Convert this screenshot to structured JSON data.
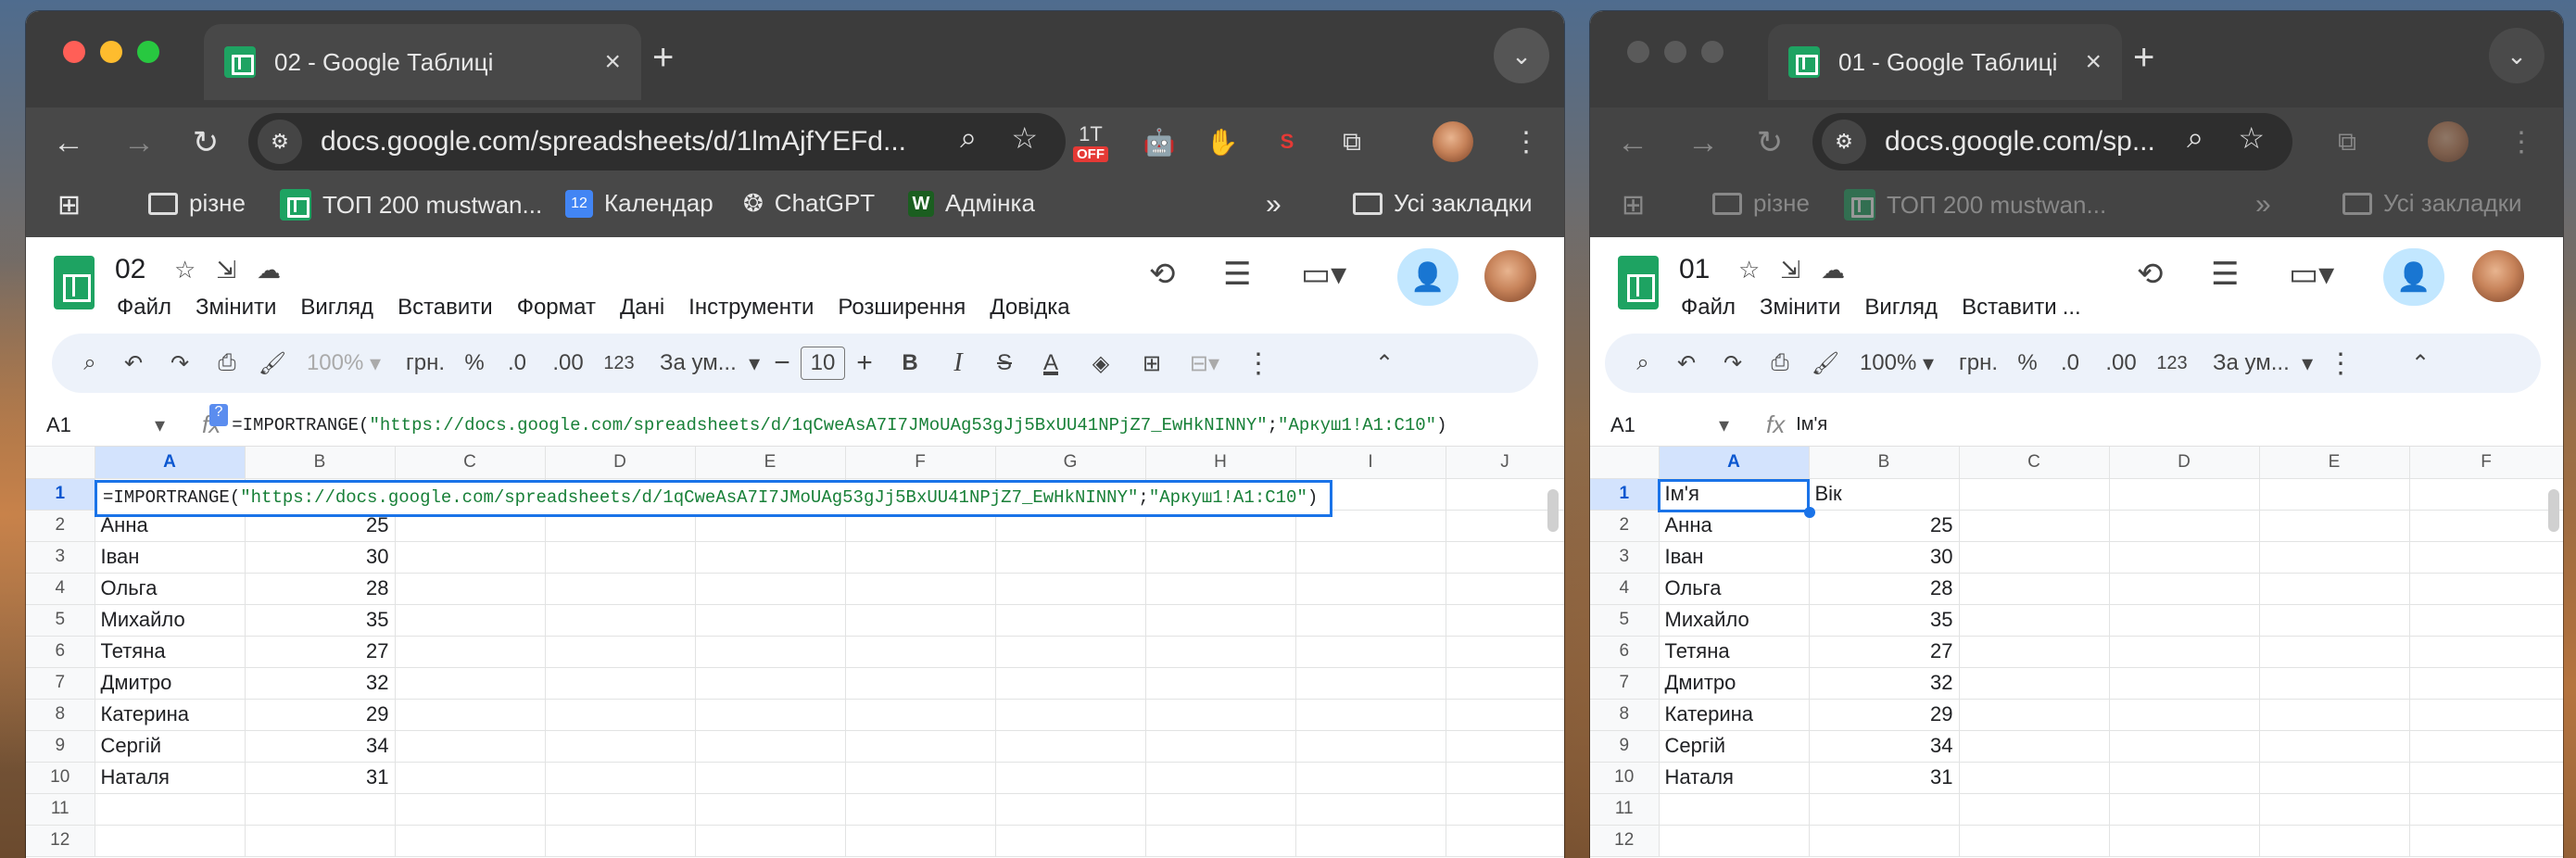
{
  "left": {
    "tab_title": "02 - Google Таблиці",
    "url": "docs.google.com/spreadsheets/d/1lmAjfYEFd...",
    "bookmarks": [
      "різне",
      "ТОП 200 mustwan...",
      "Календар",
      "ChatGPT",
      "Адмінка"
    ],
    "calendar_day": "12",
    "all_bookmarks": "Усі закладки",
    "doc_name": "02",
    "menus": [
      "Файл",
      "Змінити",
      "Вигляд",
      "Вставити",
      "Формат",
      "Дані",
      "Інструменти",
      "Розширення",
      "Довідка"
    ],
    "toolbar": {
      "zoom": "100%",
      "currency": "грн.",
      "percent": "%",
      "dec_less": ".0",
      "dec_more": ".00",
      "number": "123",
      "font": "За ум...",
      "font_size": "10"
    },
    "name_box": "A1",
    "formula_prefix": "=IMPORTRANGE(",
    "formula_url": "\"https://docs.google.com/spreadsheets/d/1qCweAsA7I7JMoUAg53gJj5BxUU41NPjZ7_EwHkNINNY\"",
    "formula_sep": ";",
    "formula_range": "\"Аркуш1!A1:C10\"",
    "formula_suffix": ")",
    "ext_off_label": "OFF",
    "columns": [
      "A",
      "B",
      "C",
      "D",
      "E",
      "F",
      "G",
      "H",
      "I",
      "J"
    ],
    "partial_row2_a": "Анна",
    "partial_row2_b": "25",
    "rows": [
      [
        "Іван",
        "30"
      ],
      [
        "Ольга",
        "28"
      ],
      [
        "Михайло",
        "35"
      ],
      [
        "Тетяна",
        "27"
      ],
      [
        "Дмитро",
        "32"
      ],
      [
        "Катерина",
        "29"
      ],
      [
        "Сергій",
        "34"
      ],
      [
        "Наталя",
        "31"
      ]
    ],
    "row_numbers": [
      "1",
      "2",
      "3",
      "4",
      "5",
      "6",
      "7",
      "8",
      "9",
      "10",
      "11",
      "12"
    ]
  },
  "right": {
    "tab_title": "01 - Google Таблиці",
    "url": "docs.google.com/sp...",
    "bookmarks": [
      "різне",
      "ТОП 200 mustwan..."
    ],
    "all_bookmarks": "Усі закладки",
    "doc_name": "01",
    "menus": [
      "Файл",
      "Змінити",
      "Вигляд",
      "Вставити",
      "..."
    ],
    "toolbar": {
      "zoom": "100%",
      "currency": "грн.",
      "percent": "%",
      "dec_less": ".0",
      "dec_more": ".00",
      "number": "123",
      "font": "За ум..."
    },
    "name_box": "A1",
    "formula": "Ім'я",
    "columns": [
      "A",
      "B",
      "C",
      "D",
      "E",
      "F"
    ],
    "rows": [
      [
        "Ім'я",
        "Вік"
      ],
      [
        "Анна",
        "25"
      ],
      [
        "Іван",
        "30"
      ],
      [
        "Ольга",
        "28"
      ],
      [
        "Михайло",
        "35"
      ],
      [
        "Тетяна",
        "27"
      ],
      [
        "Дмитро",
        "32"
      ],
      [
        "Катерина",
        "29"
      ],
      [
        "Сергій",
        "34"
      ],
      [
        "Наталя",
        "31"
      ]
    ],
    "row_numbers": [
      "1",
      "2",
      "3",
      "4",
      "5",
      "6",
      "7",
      "8",
      "9",
      "10",
      "11",
      "12"
    ]
  }
}
